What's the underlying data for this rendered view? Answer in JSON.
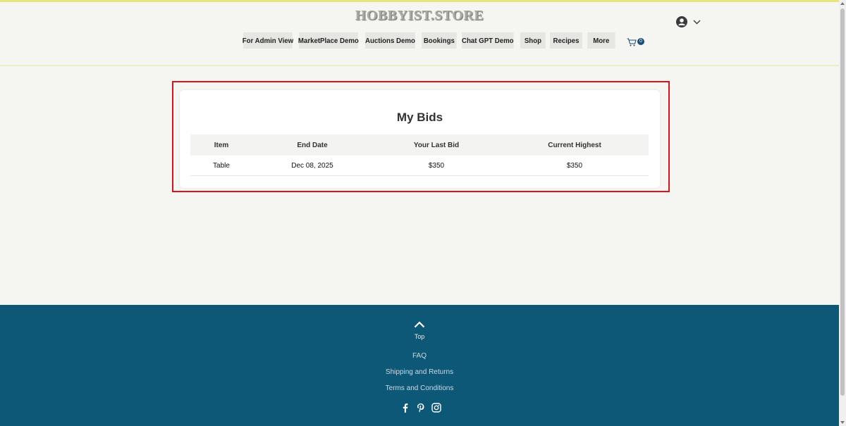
{
  "site": {
    "logo_text": "HOBBYIST.STORE"
  },
  "nav": {
    "items": [
      {
        "label": "For Admin View",
        "w": 76
      },
      {
        "label": "MarketPlace Demo",
        "w": 91
      },
      {
        "label": "Auctions Demo",
        "w": 77
      },
      {
        "label": "Bookings",
        "w": 54
      },
      {
        "label": "Chat GPT Demo",
        "w": 80
      },
      {
        "label": "Shop",
        "w": 39
      },
      {
        "label": "Recipes",
        "w": 50
      },
      {
        "label": "More",
        "w": 43
      }
    ]
  },
  "cart": {
    "count": "0"
  },
  "bids": {
    "title": "My Bids",
    "columns": [
      "Item",
      "End Date",
      "Your Last Bid",
      "Current Highest"
    ],
    "rows": [
      [
        "Table",
        "Dec 08, 2025",
        "$350",
        "$350"
      ]
    ]
  },
  "footer": {
    "top_label": "Top",
    "links": [
      "FAQ",
      "Shipping and Returns",
      "Terms and Conditions"
    ]
  },
  "colors": {
    "accent_strip": "#e8e67a",
    "footer_bg": "#0e5877",
    "highlight": "#d9121b"
  }
}
